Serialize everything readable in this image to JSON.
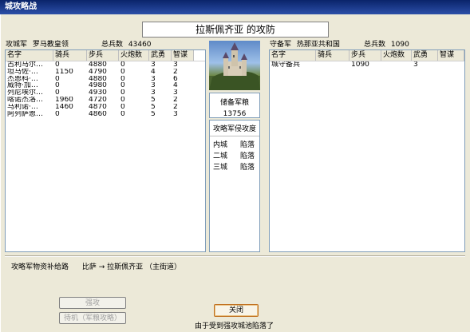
{
  "window": {
    "title": "城攻略战"
  },
  "caption": "拉斯佩齐亚 的攻防",
  "attacker": {
    "label": "攻城军",
    "name": "罗马教皇领",
    "total_label": "总兵数",
    "total": "43460",
    "columns": [
      "名字",
      "骑兵",
      "步兵",
      "火炮数",
      "武勇",
      "智谋"
    ],
    "rows": [
      [
        "古利马尔…",
        "0",
        "4880",
        "0",
        "3",
        "3"
      ],
      [
        "坦马佐·…",
        "1150",
        "4790",
        "0",
        "4",
        "2"
      ],
      [
        "杰恩科·…",
        "0",
        "4880",
        "0",
        "3",
        "6"
      ],
      [
        "威特·加…",
        "0",
        "4980",
        "0",
        "3",
        "4"
      ],
      [
        "列尼埃尔…",
        "0",
        "4930",
        "0",
        "3",
        "3"
      ],
      [
        "喀诺杰洛…",
        "1960",
        "4720",
        "0",
        "5",
        "2"
      ],
      [
        "马利诺·…",
        "1460",
        "4870",
        "0",
        "5",
        "2"
      ],
      [
        "阿列萨恩…",
        "0",
        "4860",
        "0",
        "5",
        "3"
      ]
    ]
  },
  "defender": {
    "label": "守备军",
    "name": "热那亚共和国",
    "total_label": "总兵数",
    "total": "1090",
    "columns": [
      "名字",
      "骑兵",
      "步兵",
      "火炮数",
      "武勇",
      "智谋"
    ],
    "rows": [
      [
        "城守备兵",
        "",
        "1090",
        "",
        "3",
        ""
      ]
    ]
  },
  "middle": {
    "provisions_label": "储备军粮",
    "provisions_value": "13756",
    "progress_label": "攻略军侵攻度",
    "sections": [
      {
        "name": "内城",
        "status": "陷落"
      },
      {
        "name": "二城",
        "status": "陷落"
      },
      {
        "name": "三城",
        "status": "陷落"
      }
    ]
  },
  "supply": {
    "label": "攻略军物资补给路",
    "route": "比萨 → 拉斯佩齐亚 （主街道）"
  },
  "buttons": {
    "assault": "强攻",
    "wait": "待机（军粮攻略）",
    "close": "关闭"
  },
  "status_message": "由于受到强攻城池陷落了"
}
